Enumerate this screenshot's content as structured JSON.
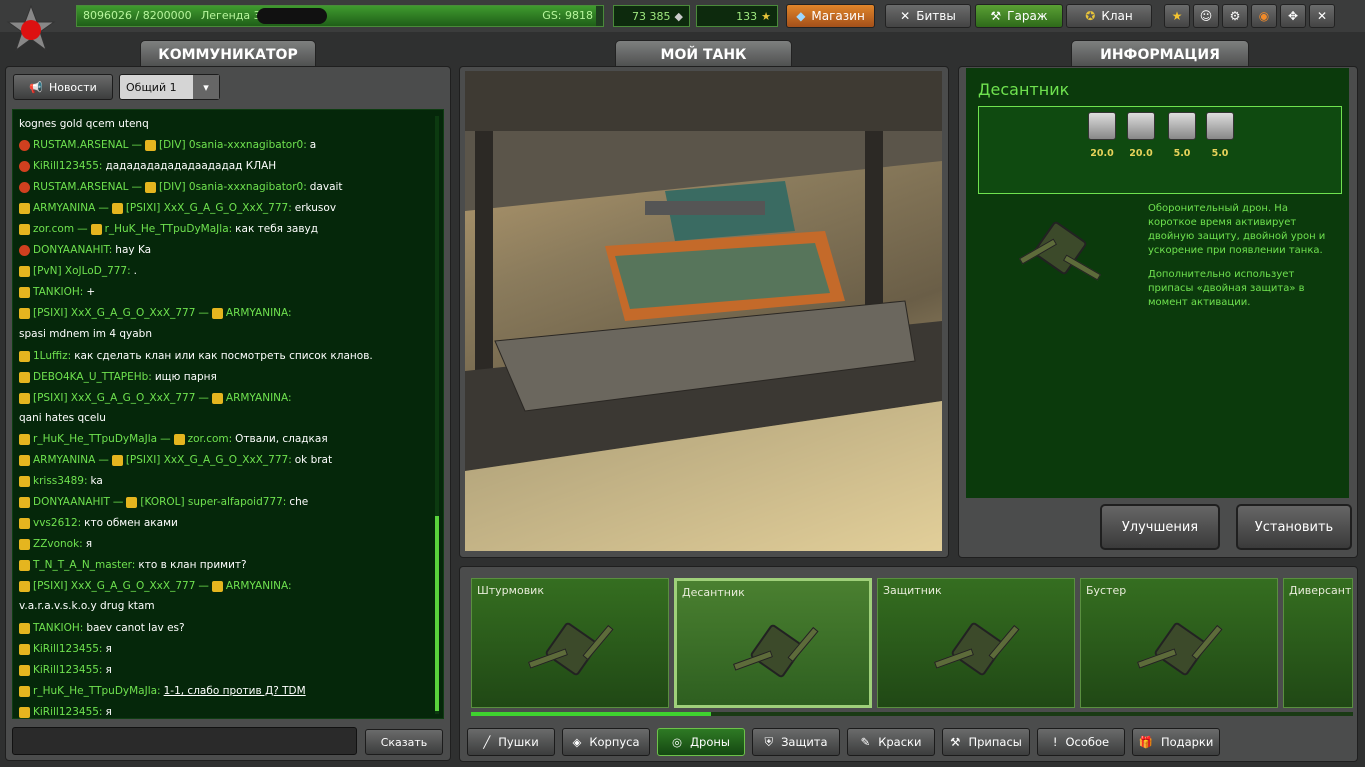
{
  "topbar": {
    "experience": "8096026 / 8200000",
    "rank_name": "Легенда 33",
    "gs": "GS: 9818",
    "crystals": "73 385",
    "stars": "133",
    "buttons": {
      "shop": "Магазин",
      "battles": "Битвы",
      "garage": "Гараж",
      "clan": "Клан"
    }
  },
  "panels": {
    "communicator": "КОММУНИКАТОР",
    "my_tank": "МОЙ ТАНК",
    "information": "ИНФОРМАЦИЯ"
  },
  "chat": {
    "news_button": "Новости",
    "channel": "Общий 1",
    "send_button": "Сказать",
    "input_value": "",
    "messages": [
      {
        "rank": "",
        "from": "",
        "to": "",
        "text": "kognes gold qcem utenq",
        "plain": true
      },
      {
        "rank": "r",
        "from": "RUSTAM.ARSENAL",
        "to": "[DIV] 0sania-xxxnagibator0:",
        "text": "a"
      },
      {
        "rank": "r",
        "from": "KiRill123455:",
        "to": "",
        "text": "дададададададаададад КЛАН"
      },
      {
        "rank": "r",
        "from": "RUSTAM.ARSENAL",
        "to": "[DIV] 0sania-xxxnagibator0:",
        "text": "davait"
      },
      {
        "rank": "y",
        "from": "ARMYANINA",
        "to": "[PSIXI] XxX_G_A_G_O_XxX_777:",
        "text": "erkusov"
      },
      {
        "rank": "y",
        "from": "zor.com",
        "to": "r_HuK_He_TTpuDyMaJla:",
        "text": "как тебя завуд"
      },
      {
        "rank": "r",
        "from": "DONYAANAHIT:",
        "to": "",
        "text": "hay Ka"
      },
      {
        "rank": "y",
        "from": "[PvN] XoJLoD_777:",
        "to": "",
        "text": "."
      },
      {
        "rank": "y",
        "from": "TANKIOH:",
        "to": "",
        "text": "+"
      },
      {
        "rank": "y",
        "from": "[PSIXI] XxX_G_A_G_O_XxX_777",
        "to": "ARMYANINA:",
        "text": ""
      },
      {
        "rank": "",
        "from": "",
        "to": "",
        "text": "spasi mdnem im 4 qyabn",
        "plain": true
      },
      {
        "rank": "y",
        "from": "1Luffiz:",
        "to": "",
        "text": "как сделать клан или как посмотреть список кланов."
      },
      {
        "rank": "y",
        "from": "DEBO4KA_U_TTAPEHb:",
        "to": "",
        "text": "ищю парня"
      },
      {
        "rank": "y",
        "from": "[PSIXI] XxX_G_A_G_O_XxX_777",
        "to": "ARMYANINA:",
        "text": ""
      },
      {
        "rank": "",
        "from": "",
        "to": "",
        "text": "qani hates qcelu",
        "plain": true
      },
      {
        "rank": "y",
        "from": "r_HuK_He_TTpuDyMaJla",
        "to": "zor.com:",
        "text": "Отвали, сладкая"
      },
      {
        "rank": "y",
        "from": "ARMYANINA",
        "to": "[PSIXI] XxX_G_A_G_O_XxX_777:",
        "text": "ok brat"
      },
      {
        "rank": "y",
        "from": "kriss3489:",
        "to": "",
        "text": "ka"
      },
      {
        "rank": "y",
        "from": "DONYAANAHIT",
        "to": "[KOROL] super-alfapoid777:",
        "text": "che"
      },
      {
        "rank": "y",
        "from": "vvs2612:",
        "to": "",
        "text": "кто обмен аками"
      },
      {
        "rank": "y",
        "from": "ZZvonok:",
        "to": "",
        "text": "я"
      },
      {
        "rank": "y",
        "from": "T_N_T_A_N_master:",
        "to": "",
        "text": "кто в клан примит?"
      },
      {
        "rank": "y",
        "from": "[PSIXI] XxX_G_A_G_O_XxX_777",
        "to": "ARMYANINA:",
        "text": ""
      },
      {
        "rank": "",
        "from": "",
        "to": "",
        "text": "v.a.r.a.v.s.k.o.y drug ktam",
        "plain": true
      },
      {
        "rank": "y",
        "from": "TANKIOH:",
        "to": "",
        "text": "baev canot lav es?"
      },
      {
        "rank": "y",
        "from": "KiRill123455:",
        "to": "",
        "text": "я"
      },
      {
        "rank": "y",
        "from": "KiRill123455:",
        "to": "",
        "text": "я"
      },
      {
        "rank": "y",
        "from": "r_HuK_He_TTpuDyMaJla:",
        "to": "",
        "text": "1-1, слабо против Д? TDM"
      },
      {
        "rank": "y",
        "from": "KiRill123455:",
        "to": "",
        "text": "я"
      }
    ]
  },
  "info": {
    "title": "Десантник",
    "stats": [
      {
        "icon": "protection-icon",
        "value": "20.0"
      },
      {
        "icon": "timer-icon",
        "value": "20.0"
      },
      {
        "icon": "armor-icon",
        "value": "5.0"
      },
      {
        "icon": "ammo-icon",
        "value": "5.0"
      }
    ],
    "description_1": "Оборонительный дрон. На короткое время активирует двойную защиту, двойной урон и ускорение при появлении танка.",
    "description_2": "Дополнительно использует припасы «двойная защита» в момент активации.",
    "upgrade_button": "Улучшения",
    "install_button": "Установить"
  },
  "drones": [
    {
      "name": "Штурмовик",
      "selected": false
    },
    {
      "name": "Десантник",
      "selected": true
    },
    {
      "name": "Защитник",
      "selected": false
    },
    {
      "name": "Бустер",
      "selected": false
    },
    {
      "name": "Диверсант",
      "selected": false
    }
  ],
  "tabs": [
    {
      "label": "Пушки",
      "icon": "cannon-icon"
    },
    {
      "label": "Корпуса",
      "icon": "hull-icon"
    },
    {
      "label": "Дроны",
      "icon": "drone-icon",
      "selected": true
    },
    {
      "label": "Защита",
      "icon": "shield-icon"
    },
    {
      "label": "Краски",
      "icon": "paint-icon"
    },
    {
      "label": "Припасы",
      "icon": "wrench-icon"
    },
    {
      "label": "Особое",
      "icon": "exclamation-icon"
    },
    {
      "label": "Подарки",
      "icon": "gift-icon"
    }
  ],
  "colors": {
    "accent": "#6fe24f",
    "gold": "#e7d35a",
    "panel": "#0b3a0c"
  }
}
